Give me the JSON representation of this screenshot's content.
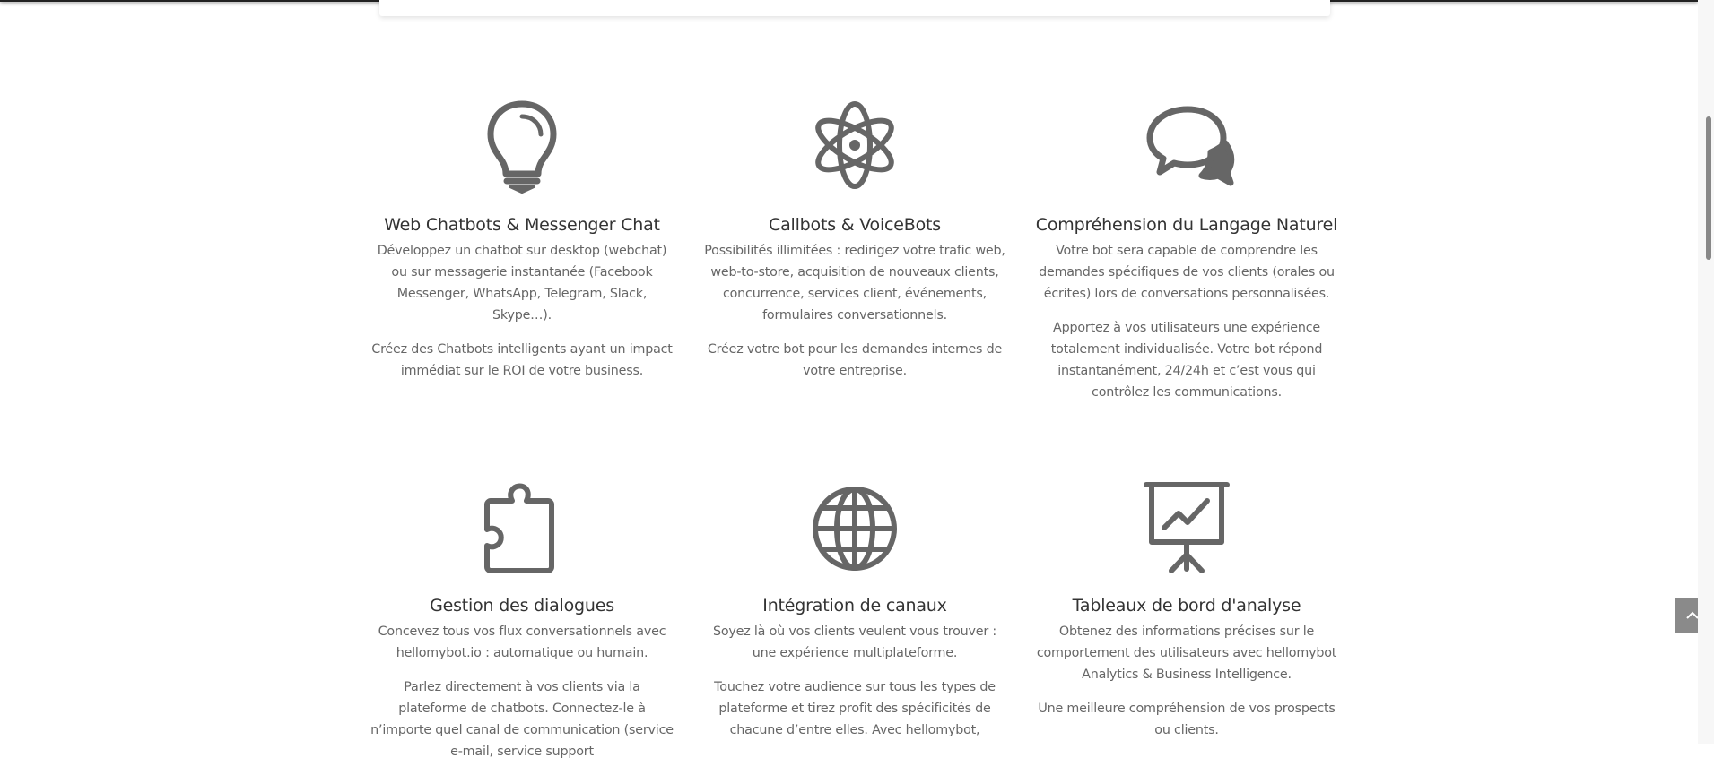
{
  "features": [
    {
      "icon": "lightbulb-icon",
      "title": "Web Chatbots & Messenger Chat",
      "paragraphs": [
        "Développez un chatbot sur desktop (webchat) ou sur messagerie instantanée (Facebook Messenger, WhatsApp, Telegram, Slack, Skype…).",
        "Créez des Chatbots intelligents ayant un impact immédiat sur le ROI de votre business."
      ]
    },
    {
      "icon": "atom-icon",
      "title": "Callbots & VoiceBots",
      "paragraphs": [
        "Possibilités illimitées : redirigez votre trafic web, web-to-store, acquisition de nouveaux clients, concurrence, services client, événements, formulaires conversationnels.",
        "Créez votre bot pour les demandes internes de votre entreprise."
      ]
    },
    {
      "icon": "chat-bubbles-icon",
      "title": "Compréhension du Langage Naturel",
      "paragraphs": [
        "Votre bot sera capable de comprendre les demandes spécifiques de vos clients (orales ou écrites) lors de conversations personnalisées.",
        "Apportez à vos utilisateurs une expérience totalement individualisée. Votre bot répond instantanément, 24/24h et c’est vous qui contrôlez les communications."
      ]
    },
    {
      "icon": "puzzle-icon",
      "title": "Gestion des dialogues",
      "paragraphs": [
        "Concevez tous vos flux conversationnels avec hellomybot.io : automatique ou humain.",
        "Parlez directement à vos clients via la plateforme de chatbots. Connectez-le à n’importe quel canal de communication (service e-mail, service support"
      ]
    },
    {
      "icon": "globe-icon",
      "title": "Intégration de canaux",
      "paragraphs": [
        "Soyez là où vos clients veulent vous trouver : une expérience multiplateforme.",
        "Touchez votre audience sur tous les types de plateforme et tirez profit des spécificités de chacune d’entre elles. Avec hellomybot,"
      ]
    },
    {
      "icon": "presentation-chart-icon",
      "title": "Tableaux de bord d'analyse",
      "paragraphs": [
        "Obtenez des informations précises sur le comportement des utilisateurs avec hellomybot Analytics & Business Intelligence.",
        "Une meilleure compréhension de vos prospects ou clients."
      ]
    }
  ],
  "back_to_top": {
    "icon": "chevron-up-icon"
  },
  "colors": {
    "icon": "#666666",
    "title": "#333333",
    "text": "#666666",
    "button": "#8a8a8a"
  }
}
